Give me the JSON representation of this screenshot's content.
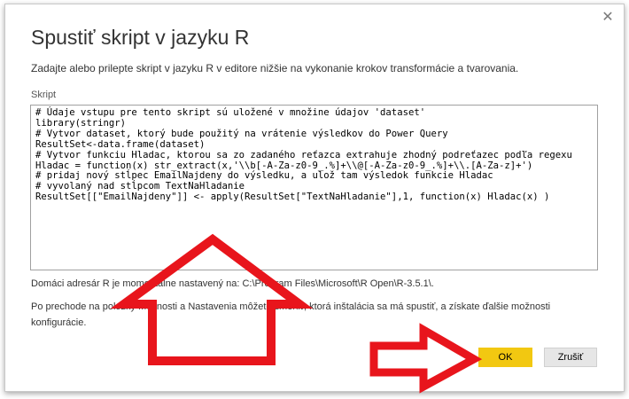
{
  "dialog": {
    "title": "Spustiť skript v jazyku R",
    "close_icon": "close-icon",
    "description": "Zadajte alebo prilepte skript v jazyku R v editore nižšie na vykonanie krokov transformácie a tvarovania.",
    "script_label": "Skript",
    "script_lines": [
      "# Údaje vstupu pre tento skript sú uložené v množine údajov 'dataset'",
      "library(stringr)",
      "# Vytvor dataset, ktorý bude použitý na vrátenie výsledkov do Power Query",
      "ResultSet<-data.frame(dataset)",
      "# Vytvor funkciu Hladac, ktorou sa zo zadaného reťazca extrahuje zhodný podreťazec podľa regexu",
      "Hladac = function(x) str_extract(x,'\\\\b[-A-Za-z0-9_.%]+\\\\@[-A-Za-z0-9_.%]+\\\\.[A-Za-z]+')",
      "# pridaj nový stĺpec EmailNajdeny do výsledku, a ulož tam výsledok funkcie Hladac",
      "# vyvolaný nad stĺpcom TextNaHladanie",
      "ResultSet[[\"EmailNajdeny\"]] <- apply(ResultSet[\"TextNaHladanie\"],1, function(x) Hladac(x) )"
    ],
    "info_line1": "Domáci adresár R je momentálne nastavený na: C:\\Program Files\\Microsoft\\R Open\\R-3.5.1\\.",
    "info_line2": "Po prechode na položky Možnosti a Nastavenia môžete zmeniť, ktorá inštalácia sa má spustiť, a získate ďalšie možnosti konfigurácie.",
    "ok_label": "OK",
    "cancel_label": "Zrušiť"
  },
  "colors": {
    "ok_button": "#f2c811",
    "annotation_arrow": "#e8151c"
  },
  "annotations": [
    "up-arrow",
    "right-arrow"
  ]
}
